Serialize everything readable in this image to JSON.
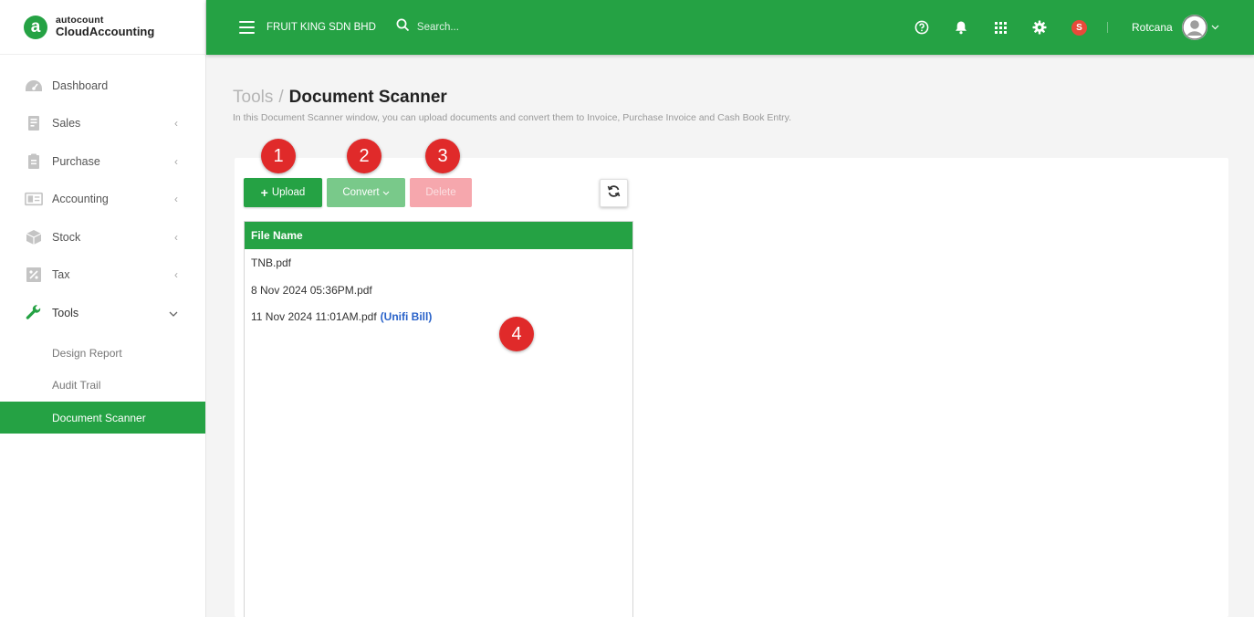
{
  "brand": {
    "logo_letter": "a",
    "line1": "autocount",
    "line2": "CloudAccounting"
  },
  "sidebar": {
    "items": [
      {
        "label": "Dashboard",
        "icon": "dashboard-icon"
      },
      {
        "label": "Sales",
        "icon": "sales-icon"
      },
      {
        "label": "Purchase",
        "icon": "purchase-icon"
      },
      {
        "label": "Accounting",
        "icon": "accounting-icon"
      },
      {
        "label": "Stock",
        "icon": "stock-icon"
      },
      {
        "label": "Tax",
        "icon": "tax-icon"
      },
      {
        "label": "Tools",
        "icon": "wrench-icon"
      }
    ],
    "tools_sub": [
      {
        "label": "Design Report"
      },
      {
        "label": "Audit Trail"
      },
      {
        "label": "Document Scanner"
      }
    ]
  },
  "topbar": {
    "company": "FRUIT KING SDN BHD",
    "search_placeholder": "Search...",
    "badge_letter": "S",
    "username": "Rotcana"
  },
  "page": {
    "breadcrumb_parent": "Tools",
    "breadcrumb_sep": "/",
    "title": "Document Scanner",
    "description": "In this Document Scanner window, you can upload documents and convert them to Invoice, Purchase Invoice and Cash Book Entry."
  },
  "toolbar": {
    "upload_label": "Upload",
    "convert_label": "Convert",
    "delete_label": "Delete"
  },
  "file_table": {
    "header": "File Name",
    "rows": [
      {
        "name": "TNB.pdf",
        "tag": ""
      },
      {
        "name": "8 Nov 2024 05:36PM.pdf",
        "tag": ""
      },
      {
        "name": "11 Nov 2024 11:01AM.pdf",
        "tag": "(Unifi Bill)"
      }
    ]
  },
  "callouts": [
    "1",
    "2",
    "3",
    "4"
  ],
  "colors": {
    "primary": "#25a244",
    "callout": "#e02a2a",
    "tag": "#2962c9"
  }
}
